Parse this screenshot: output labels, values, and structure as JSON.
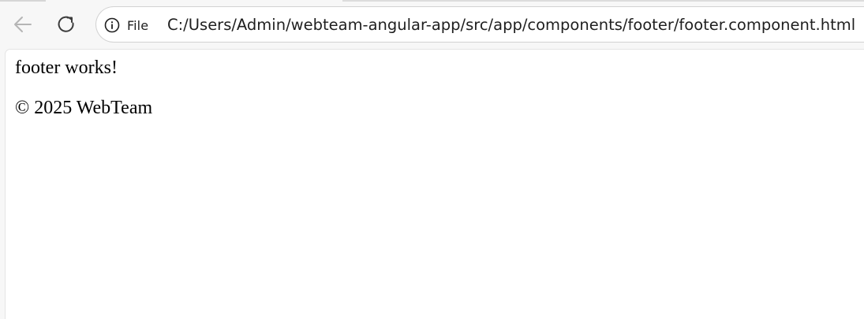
{
  "browser": {
    "back_icon": "arrow-left-icon",
    "reload_icon": "reload-icon",
    "site_info_icon": "info-circle-icon",
    "scheme_label": "File",
    "url": "C:/Users/Admin/webteam-angular-app/src/app/components/footer/footer.component.html"
  },
  "page": {
    "paragraphs": [
      "footer works!",
      "© 2025 WebTeam"
    ]
  },
  "colors": {
    "toolbar_bg": "#f7f7f7",
    "page_bg": "#ffffff",
    "text": "#000000",
    "disabled_icon": "#b5b5b5",
    "icon": "#3c3c3c"
  }
}
